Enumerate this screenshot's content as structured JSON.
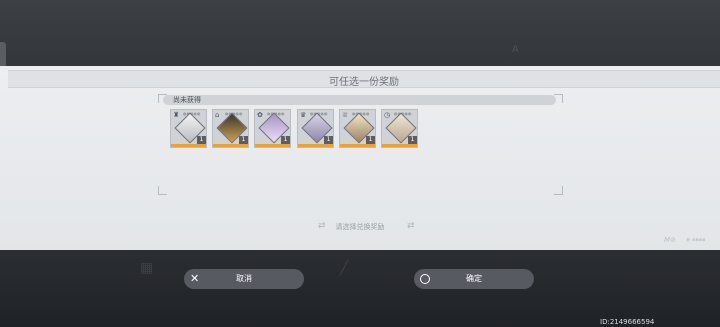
{
  "dialog": {
    "title": "可任选一份奖励",
    "status": "尚未获得",
    "hint": "请选择兑换奖励",
    "confirm_label": "确定",
    "cancel_label": "取消"
  },
  "items": [
    {
      "count": "1",
      "icon": "tower-icon"
    },
    {
      "count": "1",
      "icon": "house-icon"
    },
    {
      "count": "1",
      "icon": "flower-icon"
    },
    {
      "count": "1",
      "icon": "trophy-icon"
    },
    {
      "count": "1",
      "icon": "crown-icon"
    },
    {
      "count": "1",
      "icon": "clock-icon"
    }
  ],
  "footer": {
    "id_text": "ID:2149666594"
  },
  "colors": {
    "accent_gold": "#e7a339",
    "button_bg": "#575b61",
    "panel_bg": "#eceef0"
  }
}
